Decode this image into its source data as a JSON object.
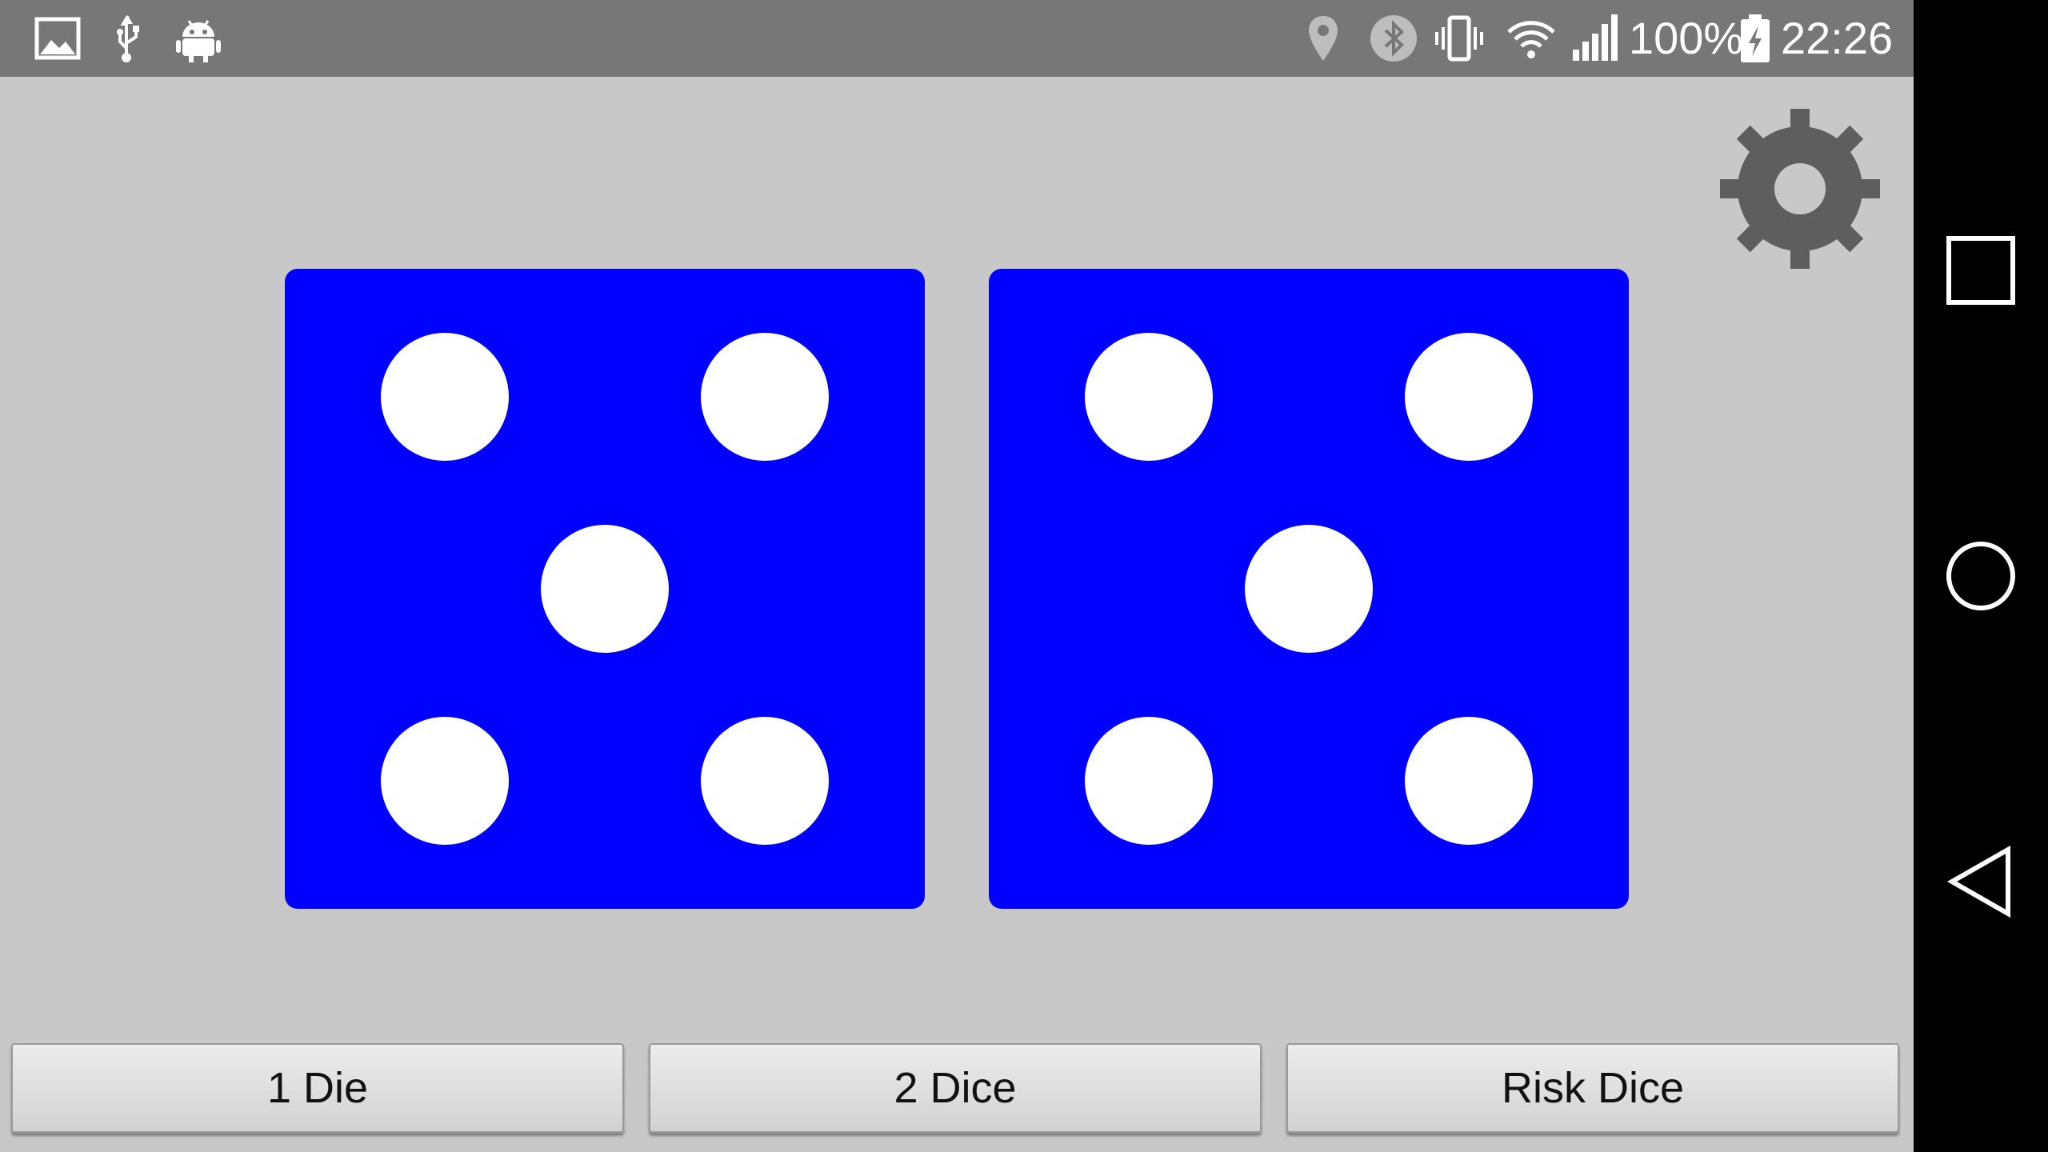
{
  "status_bar": {
    "battery": "100%",
    "time": "22:26",
    "icons_left": [
      "image-icon",
      "usb-icon",
      "android-debug-icon"
    ],
    "icons_right": [
      "location-icon",
      "bluetooth-icon",
      "vibrate-icon",
      "wifi-icon",
      "signal-icon",
      "battery-charging-icon"
    ]
  },
  "settings": {
    "icon": "gear-icon",
    "color": "#5e5e5e"
  },
  "dice": [
    {
      "value": 5,
      "color": "#0000ff"
    },
    {
      "value": 5,
      "color": "#0000ff"
    }
  ],
  "buttons": {
    "one_die": "1 Die",
    "two_dice": "2 Dice",
    "risk_dice": "Risk Dice"
  },
  "nav_bar": {
    "items": [
      "recents-square-icon",
      "home-circle-icon",
      "back-triangle-icon"
    ]
  }
}
